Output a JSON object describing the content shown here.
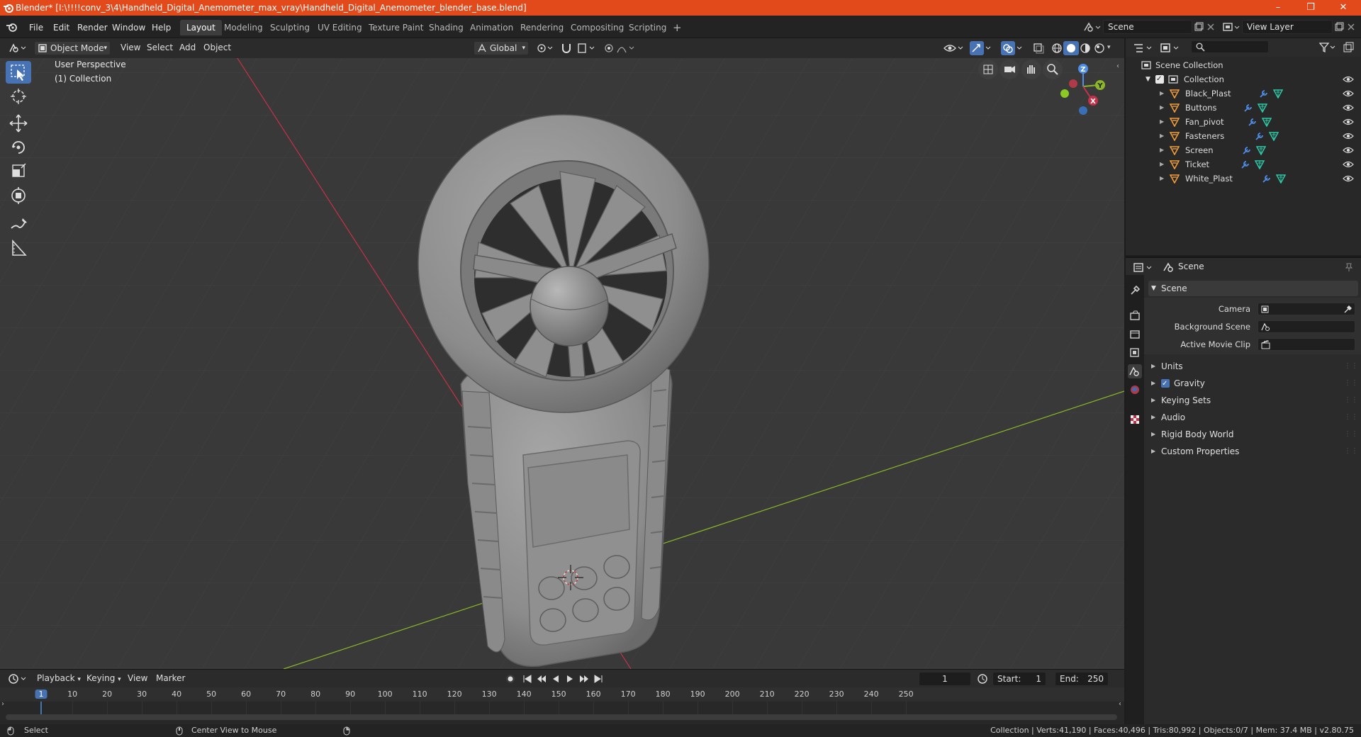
{
  "window": {
    "title": "Blender* [I:\\!!!!conv_3\\4\\Handheld_Digital_Anemometer_max_vray\\Handheld_Digital_Anemometer_blender_base.blend]",
    "minimize": "–",
    "maximize": "❐",
    "close": "✕"
  },
  "menu": [
    "File",
    "Edit",
    "Render",
    "Window",
    "Help"
  ],
  "workspaces": [
    "Layout",
    "Modeling",
    "Sculpting",
    "UV Editing",
    "Texture Paint",
    "Shading",
    "Animation",
    "Rendering",
    "Compositing",
    "Scripting"
  ],
  "workspace_add": "+",
  "scene_field": "Scene",
  "view_layer_field": "View Layer",
  "viewport_header": {
    "mode": "Object Mode",
    "menus": [
      "View",
      "Select",
      "Add",
      "Object"
    ],
    "transform_orientation": "Global"
  },
  "viewport": {
    "perspective": "User Perspective",
    "collection": "(1) Collection",
    "gizmo": {
      "x": "X",
      "y": "Y",
      "z": "Z"
    }
  },
  "timeline": {
    "menus": [
      "Playback",
      "Keying",
      "View",
      "Marker"
    ],
    "current_frame": "1",
    "start_label": "Start:",
    "start": "1",
    "end_label": "End:",
    "end": "250",
    "ticks": [
      "1",
      "10",
      "20",
      "30",
      "40",
      "50",
      "60",
      "70",
      "80",
      "90",
      "100",
      "110",
      "120",
      "130",
      "140",
      "150",
      "160",
      "170",
      "180",
      "190",
      "200",
      "210",
      "220",
      "230",
      "240",
      "250"
    ]
  },
  "status": {
    "select": "Select",
    "center_view": "Center View to Mouse",
    "stats": "Collection | Verts:41,190 | Faces:40,496 | Tris:80,992 | Objects:0/7 | Mem: 37.4 MB | v2.80.75"
  },
  "outliner": {
    "root": "Scene Collection",
    "collection": "Collection",
    "objects": [
      "Black_Plast",
      "Buttons",
      "Fan_pivot",
      "Fasteners",
      "Screen",
      "Ticket",
      "White_Plast"
    ]
  },
  "properties": {
    "header": "Scene",
    "panel": "Scene",
    "fields": [
      {
        "label": "Camera"
      },
      {
        "label": "Background Scene"
      },
      {
        "label": "Active Movie Clip"
      }
    ],
    "subpanels": [
      "Units",
      "Gravity",
      "Keying Sets",
      "Audio",
      "Rigid Body World",
      "Custom Properties"
    ]
  },
  "colors": {
    "titlebar": "#e24a1b",
    "accent": "#4772b3",
    "x_axis": "#c4314a",
    "y_axis": "#8bb727",
    "mesh_icon": "#f09d38",
    "data_icon": "#2cc9a8"
  }
}
